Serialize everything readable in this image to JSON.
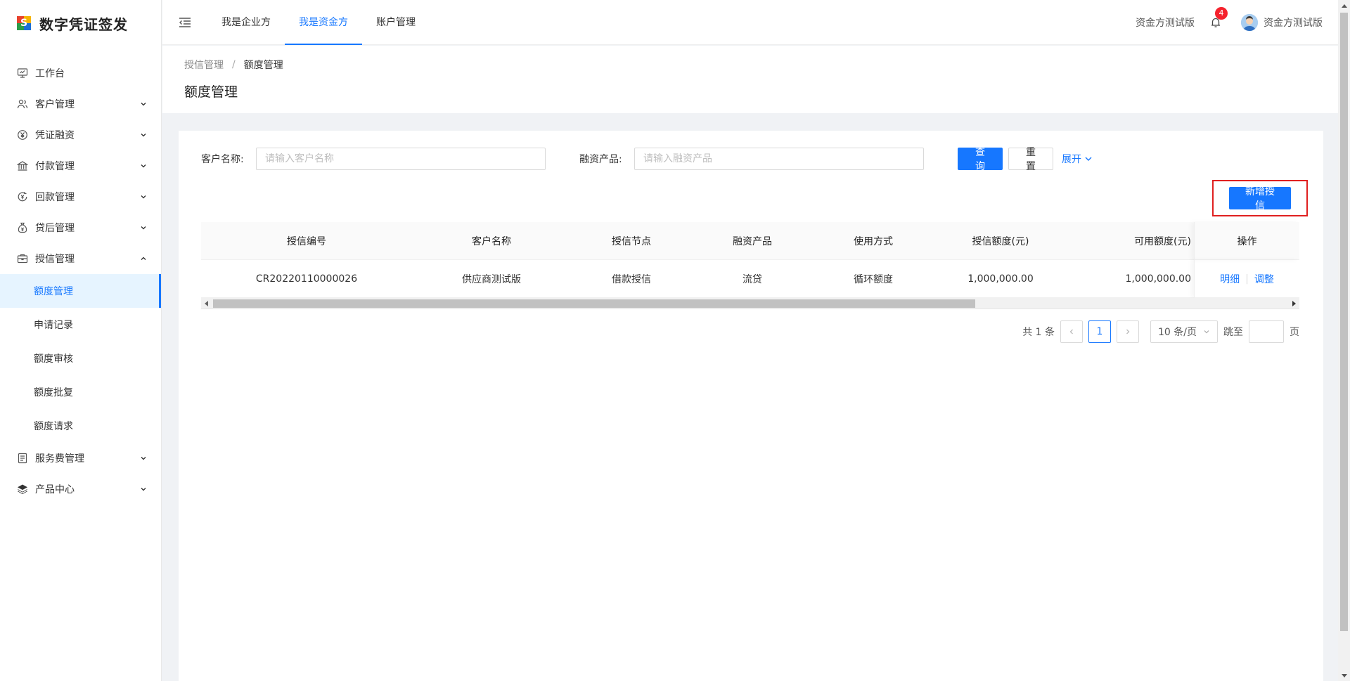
{
  "app": {
    "title": "数字凭证签发"
  },
  "sidebar": {
    "items": [
      {
        "label": "工作台",
        "icon": "monitor-icon",
        "has_children": false
      },
      {
        "label": "客户管理",
        "icon": "users-icon",
        "has_children": true
      },
      {
        "label": "凭证融资",
        "icon": "yen-circle-icon",
        "has_children": true
      },
      {
        "label": "付款管理",
        "icon": "bank-icon",
        "has_children": true
      },
      {
        "label": "回款管理",
        "icon": "refund-icon",
        "has_children": true
      },
      {
        "label": "贷后管理",
        "icon": "money-bag-icon",
        "has_children": true
      },
      {
        "label": "授信管理",
        "icon": "briefcase-icon",
        "has_children": true,
        "expanded": true,
        "children": [
          "额度管理",
          "申请记录",
          "额度审核",
          "额度批复",
          "额度请求"
        ]
      },
      {
        "label": "服务费管理",
        "icon": "receipt-icon",
        "has_children": true
      },
      {
        "label": "产品中心",
        "icon": "layers-icon",
        "has_children": true
      }
    ],
    "active_child": "额度管理"
  },
  "header": {
    "tabs": [
      "我是企业方",
      "我是资金方",
      "账户管理"
    ],
    "active_tab": "我是资金方",
    "org_name": "资金方测试版",
    "notification_count": "4",
    "user_name": "资金方测试版"
  },
  "page": {
    "breadcrumb": [
      "授信管理",
      "额度管理"
    ],
    "title": "额度管理"
  },
  "filters": {
    "customer_label": "客户名称:",
    "customer_placeholder": "请输入客户名称",
    "product_label": "融资产品:",
    "product_placeholder": "请输入融资产品",
    "query_label": "查 询",
    "reset_label": "重 置",
    "expand_label": "展开"
  },
  "actions": {
    "add_label": "新增授信"
  },
  "table": {
    "columns": [
      "授信编号",
      "客户名称",
      "授信节点",
      "融资产品",
      "使用方式",
      "授信额度(元)",
      "可用额度(元)",
      "操作"
    ],
    "rows": [
      {
        "id": "CR20220110000026",
        "customer": "供应商测试版",
        "node": "借款授信",
        "product": "流贷",
        "usage": "循环额度",
        "credit": "1,000,000.00",
        "available": "1,000,000.00",
        "op_detail": "明细",
        "op_adjust": "调整"
      }
    ]
  },
  "pagination": {
    "total_text": "共 1 条",
    "current_page": "1",
    "page_size": "10 条/页",
    "jump_label": "跳至",
    "page_suffix": "页"
  }
}
